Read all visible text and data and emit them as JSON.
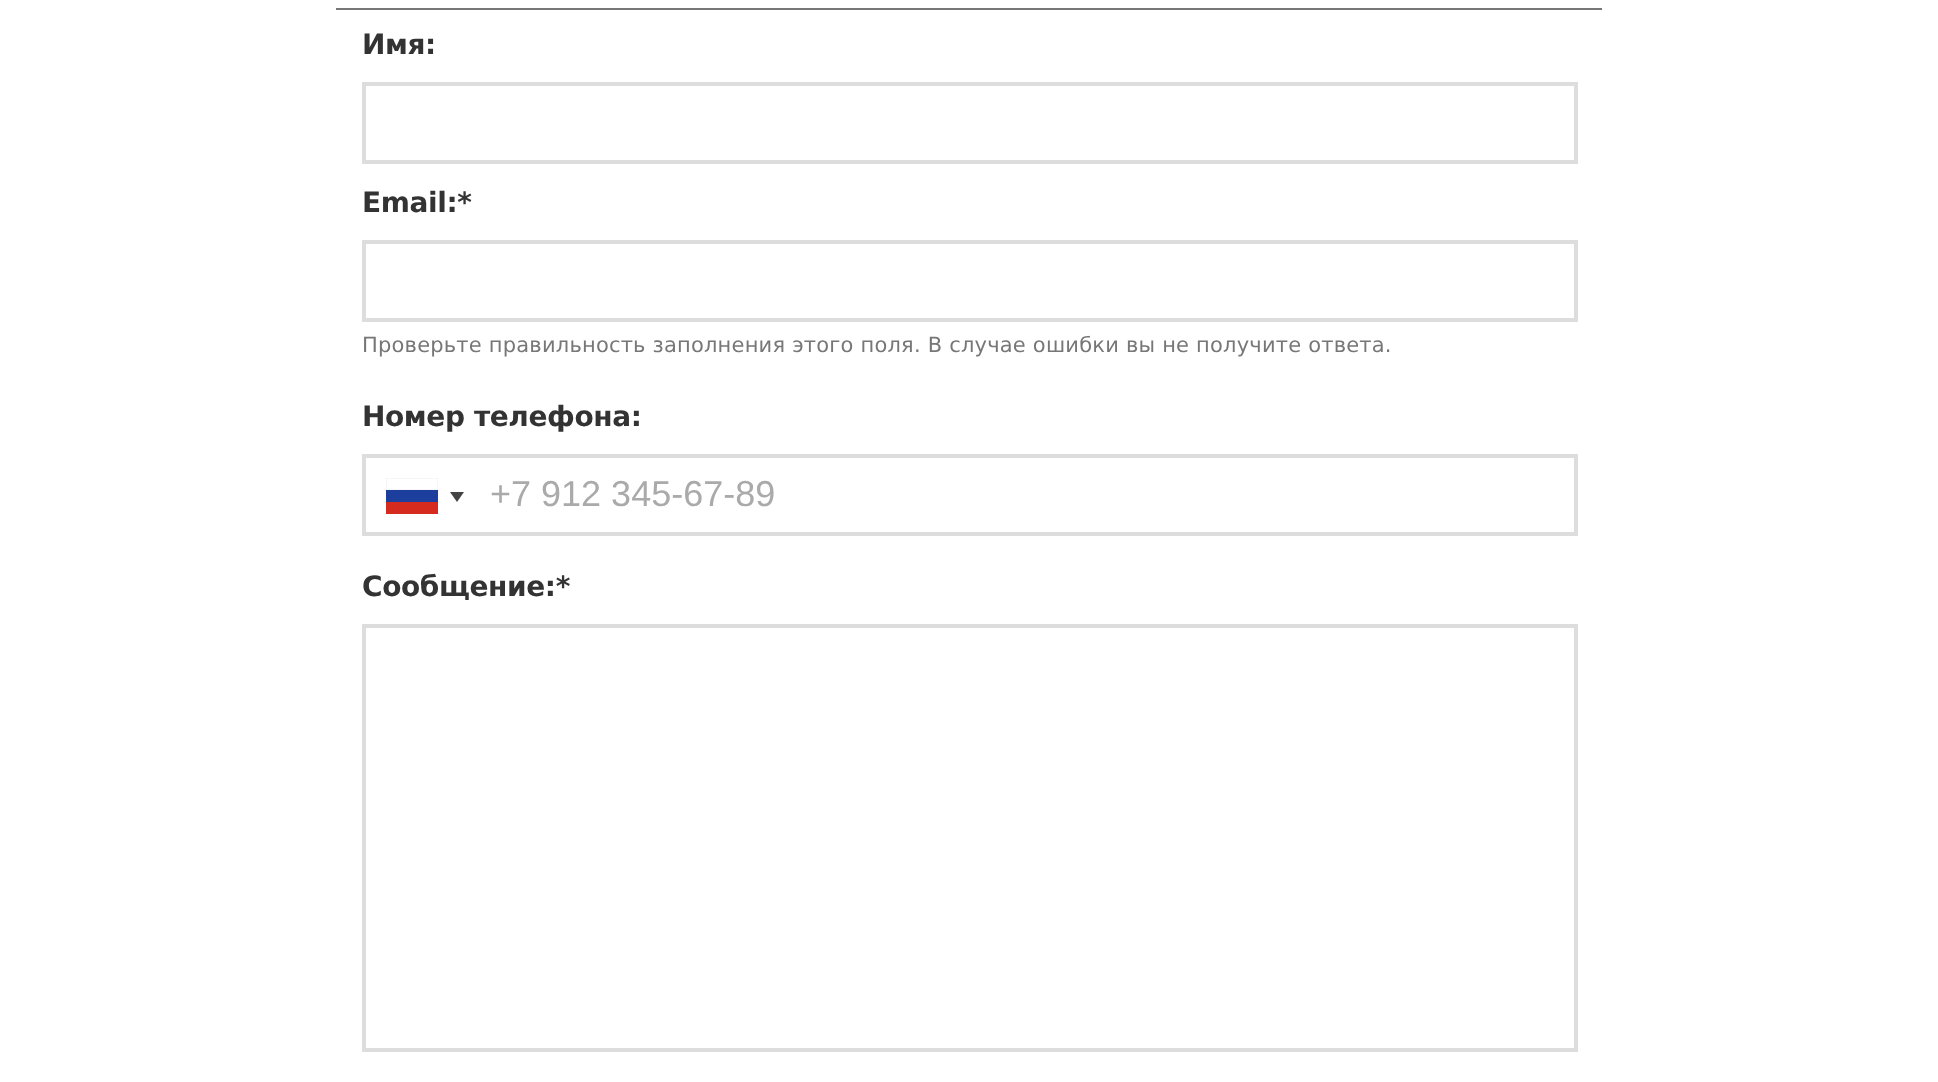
{
  "fields": [
    {
      "kind": "text",
      "label": "Имя:"
    },
    {
      "kind": "text",
      "label": "Email:*",
      "hint": "Проверьте правильность заполнения этого поля. В случае ошибки вы не получите ответа."
    },
    {
      "kind": "phone",
      "label": "Номер телефона:",
      "placeholder": "+7 912 345-67-89"
    },
    {
      "kind": "textarea",
      "label": "Сообщение:*"
    }
  ]
}
